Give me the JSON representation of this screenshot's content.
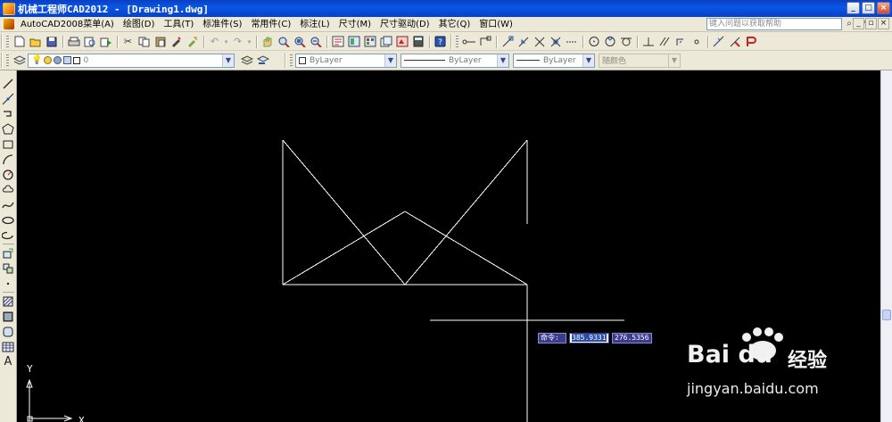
{
  "window": {
    "title": "机械工程师CAD2012 - [Drawing1.dwg]"
  },
  "menu": {
    "items": [
      "AutoCAD2008菜单(A)",
      "绘图(D)",
      "工具(T)",
      "标准件(S)",
      "常用件(C)",
      "标注(L)",
      "尺寸(M)",
      "尺寸驱动(D)",
      "其它(Q)",
      "窗口(W)"
    ],
    "help_placeholder": "键入问题以获取帮助"
  },
  "toolbar2": {
    "layer_value": "0",
    "color_value": "ByLayer",
    "linetype_value": "ByLayer",
    "lineweight_value": "ByLayer",
    "plotstyle_value": "随颜色"
  },
  "canvas": {
    "background": "#000000",
    "line_color": "#ffffff",
    "ucs_y_label": "Y",
    "ucs_x_label": "X"
  },
  "dynamic_input": {
    "label": "命令:",
    "x_value": "385.9331",
    "y_value": "276.5356"
  },
  "watermark": {
    "brand": "Bai du",
    "brand_cn": "经验",
    "url": "jingyan.baidu.com"
  },
  "icons": {
    "toolbar1": [
      "new-icon",
      "open-icon",
      "save-icon",
      "print-icon",
      "print-preview-icon",
      "publish-icon",
      "cut-icon",
      "copy-icon",
      "paste-icon",
      "match-properties-icon",
      "block-editor-icon",
      "undo-icon",
      "redo-icon",
      "pan-icon",
      "zoom-realtime-icon",
      "zoom-window-icon",
      "zoom-previous-icon",
      "properties-icon",
      "design-center-icon",
      "tool-palettes-icon",
      "sheet-set-icon",
      "markup-icon",
      "calculator-icon",
      "help-icon"
    ],
    "left": [
      "line-icon",
      "construction-line-icon",
      "polyline-icon",
      "polygon-icon",
      "rectangle-icon",
      "arc-icon",
      "circle-icon",
      "revision-cloud-icon",
      "spline-icon",
      "ellipse-icon",
      "ellipse-arc-icon",
      "insert-block-icon",
      "make-block-icon",
      "point-icon",
      "hatch-icon",
      "gradient-icon",
      "region-icon",
      "table-icon",
      "multiline-text-icon"
    ]
  }
}
